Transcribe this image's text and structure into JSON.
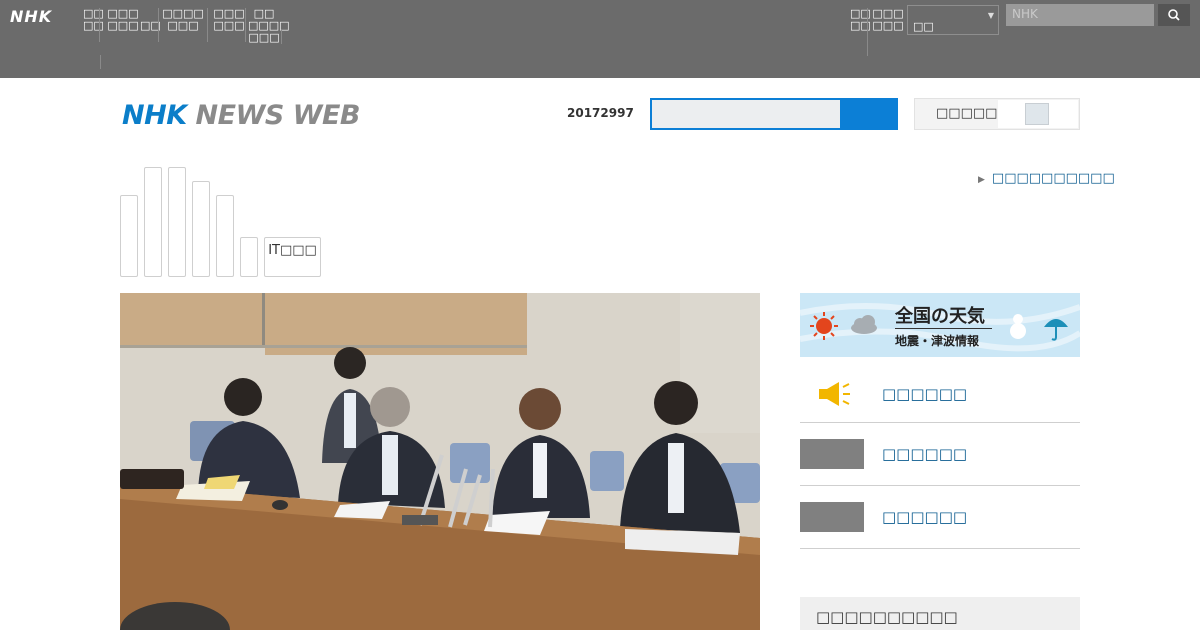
{
  "global_nav": {
    "logo": "NHK",
    "items": [
      {
        "label": "□□\n□□"
      },
      {
        "label": "□□□\n□□□"
      },
      {
        "label": "□□"
      },
      {
        "label": "□□□□\n□□□"
      },
      {
        "label": "□□□\n□□□"
      },
      {
        "label": "□□\n□□□□\n□□□"
      }
    ],
    "right_items": [
      {
        "label": "□□\n□□"
      },
      {
        "label": "□□□\n□□□"
      }
    ],
    "region_select": "□□",
    "search_placeholder": "NHK"
  },
  "header": {
    "logo_nhk": "NHK",
    "logo_news": "NEWS WEB",
    "date": "20172997",
    "search_value": "",
    "toggle_label": "□□□□□",
    "site_link": "□□□□□□□□□□"
  },
  "category_tabs": {
    "blank_tabs": 6,
    "it_tab": "IT□□□"
  },
  "main_photo": {
    "description_hidden": true
  },
  "sidebar": {
    "weather_title": "全国の天気",
    "weather_sub": "地震・津波情報",
    "links": [
      {
        "label": "□□□□□□",
        "icon": "megaphone-icon"
      },
      {
        "label": "□□□□□□",
        "icon": "thumbnail"
      },
      {
        "label": "□□□□□□",
        "icon": "thumbnail"
      }
    ],
    "box_title": "□□□□□□□□□□"
  },
  "colors": {
    "top_bar": "#6b6b6b",
    "nhk_blue": "#0b7ec9",
    "search_blue": "#0c7fd6",
    "link": "#0b5b8f",
    "weather_bg": "#cbe7f6"
  }
}
